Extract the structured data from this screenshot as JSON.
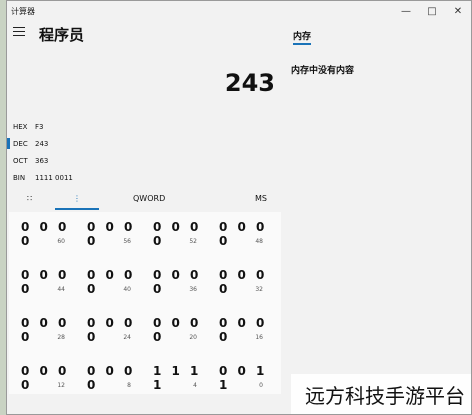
{
  "window": {
    "title": "计算器",
    "minimize_icon": "minimize-icon",
    "maximize_icon": "maximize-icon",
    "close_icon": "close-icon"
  },
  "header": {
    "mode_title": "程序员",
    "memory_tab": "内存",
    "memory_empty": "内存中没有内容"
  },
  "display": {
    "value": "243"
  },
  "radix": [
    {
      "label": "HEX",
      "value": "F3"
    },
    {
      "label": "DEC",
      "value": "243",
      "selected": true
    },
    {
      "label": "OCT",
      "value": "363"
    },
    {
      "label": "BIN",
      "value": "1111 0011"
    }
  ],
  "toolbar": {
    "keypad_icon": "keypad-icon",
    "bit_toggle_icon": "bit-toggle-icon",
    "word_size": "QWORD",
    "memory_store": "MS"
  },
  "bit_rows": [
    {
      "bits": [
        "0 0 0 0",
        "0 0 0 0",
        "0 0 0 0",
        "0 0 0 0"
      ],
      "positions": [
        "60",
        "56",
        "52",
        "48"
      ]
    },
    {
      "bits": [
        "0 0 0 0",
        "0 0 0 0",
        "0 0 0 0",
        "0 0 0 0"
      ],
      "positions": [
        "44",
        "40",
        "36",
        "32"
      ]
    },
    {
      "bits": [
        "0 0 0 0",
        "0 0 0 0",
        "0 0 0 0",
        "0 0 0 0"
      ],
      "positions": [
        "28",
        "24",
        "20",
        "16"
      ]
    },
    {
      "bits": [
        "0 0 0 0",
        "0 0 0 0",
        "1 1 1 1",
        "0 0 1 1"
      ],
      "positions": [
        "12",
        "8",
        "4",
        "0"
      ]
    }
  ],
  "colors": {
    "accent": "#1a73b8",
    "background": "#f2f2f2"
  },
  "watermark": "远方科技手游平台"
}
